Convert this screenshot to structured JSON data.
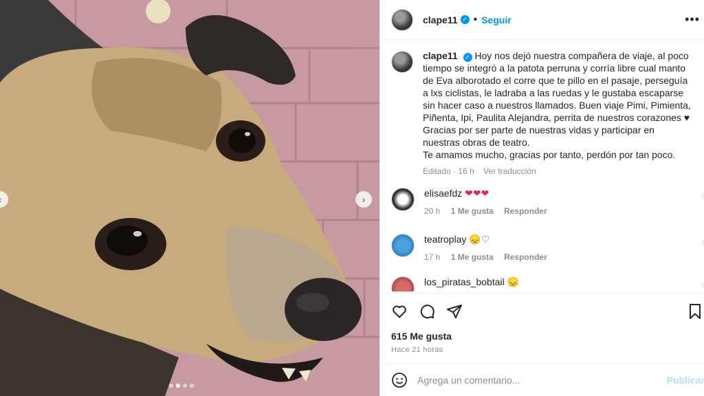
{
  "post": {
    "username": "clape11",
    "follow_label": "Seguir",
    "more_label": "•••",
    "caption": "Hoy nos dejó nuestra compañera de viaje, al poco tiempo se integró a la patota perruna y corría libre cual manto de Eva alborotado el corre que te pillo en el pasaje, perseguía a lxs ciclistas, le ladraba a las ruedas y le gustaba escaparse sin hacer caso a nuestros llamados. Buen viaje Pimi, Pimienta, Piñenta, Ipi, Paulita Alejandra, perrita de nuestros corazones ♥\nGracias por ser parte de nuestras vidas y participar en nuestras obras de teatro.\nTe amamos mucho, gracias por tanto, perdón por tan poco.",
    "edited": "Editado · 16 h",
    "translate": "Ver traducción"
  },
  "comments": [
    {
      "username": "elisaefdz",
      "text": "❤❤❤",
      "time": "20 h",
      "likes": "1 Me gusta",
      "reply": "Responder"
    },
    {
      "username": "teatroplay",
      "text": "😞♡",
      "time": "17 h",
      "likes": "1 Me gusta",
      "reply": "Responder"
    },
    {
      "username": "los_piratas_bobtail",
      "text": "😞"
    }
  ],
  "actions": {
    "likes": "615 Me gusta",
    "timestamp": "Hace 21 horas"
  },
  "add_comment": {
    "placeholder": "Agrega un comentario...",
    "publish": "Publicar"
  },
  "carousel": {
    "slides": 4,
    "active_index": 1
  },
  "icons": [
    "like-icon",
    "comment-icon",
    "share-icon",
    "bookmark-icon",
    "emoji-icon",
    "verified-icon"
  ]
}
